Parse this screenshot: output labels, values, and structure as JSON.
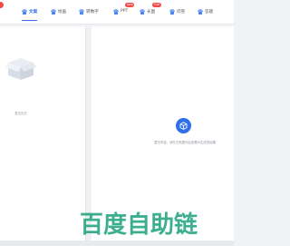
{
  "tabs": [
    {
      "label": "文案",
      "active": true,
      "badge": "",
      "icon": "document-icon"
    },
    {
      "label": "绘画",
      "active": false,
      "badge": "",
      "icon": "brush-icon"
    },
    {
      "label": "转数字",
      "active": false,
      "badge": "",
      "icon": "digital-human-icon"
    },
    {
      "label": "PPT",
      "active": false,
      "badge": "new",
      "icon": "slides-icon"
    },
    {
      "label": "长图",
      "active": false,
      "badge": "hot",
      "icon": "long-image-icon"
    },
    {
      "label": "问卷",
      "active": false,
      "badge": "",
      "icon": "survey-icon"
    },
    {
      "label": "答题",
      "active": false,
      "badge": "",
      "icon": "quiz-icon"
    }
  ],
  "left_panel": {
    "empty_text": "暂无历史"
  },
  "right_panel": {
    "hint": "暂无内容，请在左侧提问后查看AI生成的结果"
  },
  "watermark": {
    "text": "百度自助链"
  },
  "colors": {
    "accent": "#2f6fe8",
    "badge": "#f24a46",
    "watermark": "#1aa17a"
  }
}
